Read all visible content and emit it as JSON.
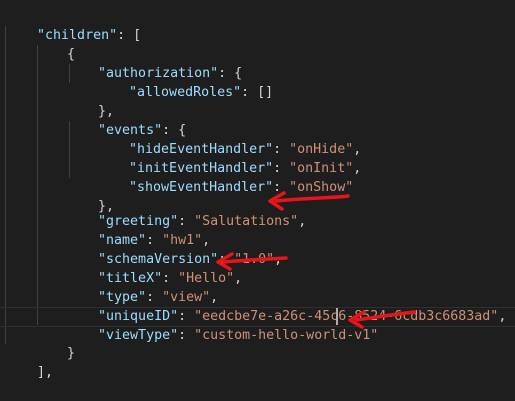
{
  "lines": {
    "l01": {
      "key": "\"children\"",
      "rest": ": ["
    },
    "l02": {
      "text": "{"
    },
    "l03": {
      "key": "\"authorization\"",
      "rest": ": {"
    },
    "l04": {
      "key": "\"allowedRoles\"",
      "rest": ": []"
    },
    "l05": {
      "text": "},"
    },
    "l06": {
      "key": "\"events\"",
      "rest": ": {"
    },
    "l07": {
      "key": "\"hideEventHandler\"",
      "sep": ": ",
      "val": "\"onHide\"",
      "end": ","
    },
    "l08": {
      "key": "\"initEventHandler\"",
      "sep": ": ",
      "val": "\"onInit\"",
      "end": ","
    },
    "l09": {
      "key": "\"showEventHandler\"",
      "sep": ": ",
      "val": "\"onShow\"",
      "end": ""
    },
    "l10": {
      "text": "},"
    },
    "l11": {
      "key": "\"greeting\"",
      "sep": ": ",
      "val": "\"Salutations\"",
      "end": ","
    },
    "l12": {
      "key": "\"name\"",
      "sep": ": ",
      "val": "\"hw1\"",
      "end": ","
    },
    "l13": {
      "key": "\"schemaVersion\"",
      "sep": ": ",
      "val": "\"1.0\"",
      "end": ","
    },
    "l14": {
      "key": "\"titleX\"",
      "sep": ": ",
      "val": "\"Hello\"",
      "end": ","
    },
    "l15": {
      "key": "\"type\"",
      "sep": ": ",
      "val": "\"view\"",
      "end": ","
    },
    "l16": {
      "key": "\"uniqueID\"",
      "sep": ": ",
      "val": "\"eedcbe7e-a26c-45c6-8524-6cdb3c6683ad\"",
      "end": ","
    },
    "l17": {
      "key": "\"viewType\"",
      "sep": ": ",
      "val": "\"custom-hello-world-v1\"",
      "end": ""
    },
    "l18": {
      "text": "}"
    },
    "l19": {
      "text": "],"
    }
  },
  "colors": {
    "background": "#1e1e1e",
    "json_key": "#9cdcfe",
    "json_string": "#ce9178",
    "punctuation": "#d4d4d4",
    "annotation_arrow": "#e8141a"
  },
  "annotations": [
    "red-arrow-greeting",
    "red-arrow-titleX",
    "red-arrow-viewType"
  ]
}
